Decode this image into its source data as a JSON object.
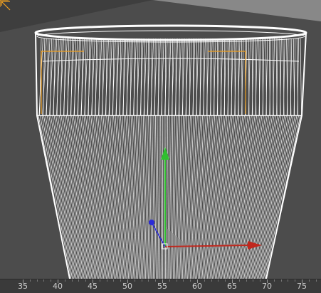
{
  "viewport": {
    "name": "3d-viewport",
    "background_color": "#4c4c4c",
    "wireframe_color": "#ffffff",
    "selection_bracket_color": "#f0a020"
  },
  "gizmo": {
    "x_axis_color": "#c0281e",
    "y_axis_color": "#2fbf2f",
    "z_axis_color": "#2a2ad8"
  },
  "timeline_ruler": {
    "tick_labels": [
      "35",
      "40",
      "45",
      "50",
      "55",
      "60",
      "65",
      "70",
      "75"
    ]
  }
}
